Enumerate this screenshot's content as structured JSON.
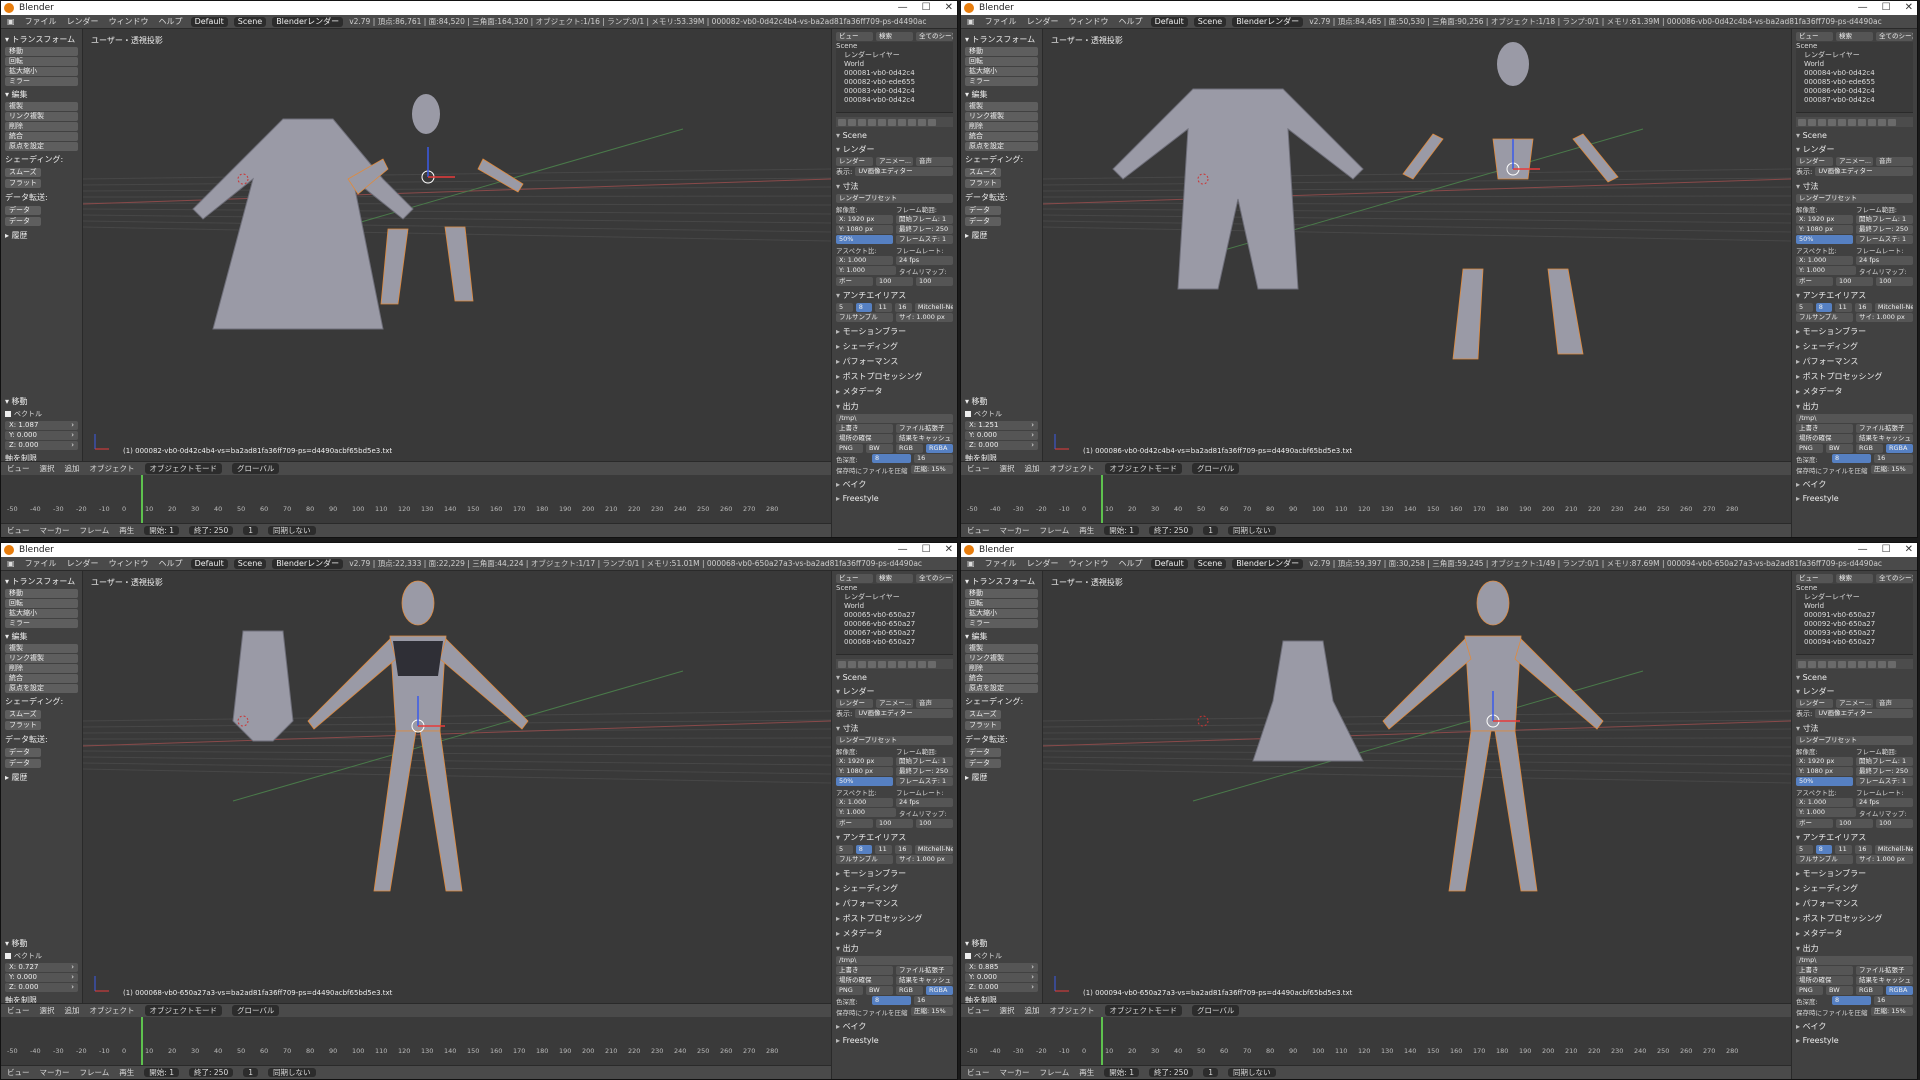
{
  "app_title": "Blender",
  "window_buttons": [
    "—",
    "☐",
    "✕"
  ],
  "menu": [
    "ファイル",
    "レンダー",
    "ウィンドウ",
    "ヘルプ"
  ],
  "layout": "Default",
  "scene": "Scene",
  "engine": "Blenderレンダー",
  "toolshelf": {
    "transform_head": "▾ トランスフォーム",
    "transform_buttons": [
      "移動",
      "回転",
      "拡大縮小",
      "ミラー"
    ],
    "edit_head": "▾ 編集",
    "edit_buttons": [
      "複製",
      "リンク複製",
      "削除",
      "統合"
    ],
    "origin": "原点を設定",
    "shading_head": "シェーディング:",
    "shading_buttons": [
      "スムーズ",
      "フラット"
    ],
    "data_head": "データ転送:",
    "data_buttons": [
      "データ",
      "データ"
    ],
    "history_head": "▸ 履歴",
    "op_head": "▾ 移動",
    "vector_head": "ベクトル",
    "constraint_head": "軸を制限",
    "axes": [
      "X",
      "Y",
      "Z"
    ]
  },
  "viewport_label": "ユーザー・透視投影",
  "viewheader": [
    "ビュー",
    "選択",
    "追加",
    "オブジェクト",
    "オブジェクトモード",
    "グローバル"
  ],
  "timeline_header": [
    "ビュー",
    "マーカー",
    "フレーム",
    "再生",
    "開始:",
    "1",
    "終了:",
    "250",
    "1",
    "同期しない"
  ],
  "timeline_ticks": [
    "-50",
    "-40",
    "-30",
    "-20",
    "-10",
    "0",
    "10",
    "20",
    "30",
    "40",
    "50",
    "60",
    "70",
    "80",
    "90",
    "100",
    "110",
    "120",
    "130",
    "140",
    "150",
    "160",
    "170",
    "180",
    "190",
    "200",
    "210",
    "220",
    "230",
    "240",
    "250",
    "260",
    "270",
    "280"
  ],
  "properties": {
    "header_tabs": [
      "ビュー",
      "検索",
      "全てのシーン"
    ],
    "outliner_items": [
      "Scene",
      "レンダーレイヤー",
      "World"
    ],
    "scene_label": "Scene",
    "render_head": "レンダー",
    "render_buttons": [
      "レンダー",
      "アニメー...",
      "音声"
    ],
    "display_label": "表示:",
    "display_value": "UV画像エディター",
    "dim_head": "寸法",
    "preset": "レンダープリセット",
    "res_label": "解像度:",
    "res_x": "X: 1920 px",
    "res_y": "Y: 1080 px",
    "res_pct": "50%",
    "frame_label": "フレーム範囲:",
    "frame_start": "開始フレーム: 1",
    "frame_end": "最終フレー: 250",
    "frame_step": "フレームステ: 1",
    "aspect_label": "アスペクト比:",
    "aspect_x": "X: 1.000",
    "aspect_y": "Y: 1.000",
    "fps_label": "フレームレート:",
    "fps": "24 fps",
    "time_remap": "タイムリマップ:",
    "remap_old": "100",
    "remap_new": "100",
    "border": "ボー",
    "aa_head": "アンチエイリアス",
    "aa_samples": [
      "5",
      "8",
      "11",
      "16"
    ],
    "aa_filter": "Mitchell-Netravali",
    "full_sample": "フルサンプル",
    "filter_size": "サイ: 1.000 px",
    "closed_sections": [
      "モーションブラー",
      "シェーディング",
      "パフォーマンス",
      "ポストプロセッシング",
      "メタデータ"
    ],
    "output_head": "出力",
    "output_path": "/tmp\\",
    "overwrite": "上書き",
    "file_ext": "ファイル拡張子",
    "placeholders": "場所の確保",
    "cache": "結果をキャッシュ",
    "format": "PNG",
    "color_modes": [
      "BW",
      "RGB",
      "RGBA"
    ],
    "color_label": "色深度:",
    "color_depth": [
      "8",
      "16"
    ],
    "compression": "圧縮: 15%",
    "compression_label": "保存時にファイルを圧縮",
    "bake_head": "ベイク",
    "freestyle_head": "Freestyle"
  },
  "windows": [
    {
      "stats": "v2.79 | 頂点:86,761 | 面:84,520 | 三角面:164,320 | オブジェクト:1/16 | ランプ:0/1 | メモリ:53.39M | 000082-vb0-0d42c4b4-vs-ba2ad81fa36ff709-ps-d4490ac",
      "vector_x": "X: 1.087",
      "vector_y": "Y: 0.000",
      "vector_z": "Z: 0.000",
      "objects": [
        "000081-vb0-0d42c4",
        "000082-vb0-ede655",
        "000083-vb0-0d42c4",
        "000084-vb0-0d42c4"
      ],
      "info": "(1) 000082-vb0-0d42c4b4-vs=ba2ad81fa36ff709-ps=d4490acbf65bd5e3.txt"
    },
    {
      "stats": "v2.79 | 頂点:84,465 | 面:50,530 | 三角面:90,256 | オブジェクト:1/18 | ランプ:0/1 | メモリ:61.39M | 000086-vb0-0d42c4b4-vs-ba2ad81fa36ff709-ps-d4490ac",
      "vector_x": "X: 1.251",
      "vector_y": "Y: 0.000",
      "vector_z": "Z: 0.000",
      "objects": [
        "000084-vb0-0d42c4",
        "000085-vb0-ede655",
        "000086-vb0-0d42c4",
        "000087-vb0-0d42c4"
      ],
      "info": "(1) 000086-vb0-0d42c4b4-vs=ba2ad81fa36ff709-ps=d4490acbf65bd5e3.txt"
    },
    {
      "stats": "v2.79 | 頂点:22,333 | 面:22,229 | 三角面:44,224 | オブジェクト:1/17 | ランプ:0/1 | メモリ:51.01M | 000068-vb0-650a27a3-vs-ba2ad81fa36ff709-ps-d4490ac",
      "vector_x": "X: 0.727",
      "vector_y": "Y: 0.000",
      "vector_z": "Z: 0.000",
      "objects": [
        "000065-vb0-650a27",
        "000066-vb0-650a27",
        "000067-vb0-650a27",
        "000068-vb0-650a27"
      ],
      "info": "(1) 000068-vb0-650a27a3-vs=ba2ad81fa36ff709-ps=d4490acbf65bd5e3.txt"
    },
    {
      "stats": "v2.79 | 頂点:59,397 | 面:30,258 | 三角面:59,245 | オブジェクト:1/49 | ランプ:0/1 | メモリ:87.69M | 000094-vb0-650a27a3-vs-ba2ad81fa36ff709-ps-d4490ac",
      "vector_x": "X: 0.885",
      "vector_y": "Y: 0.000",
      "vector_z": "Z: 0.000",
      "objects": [
        "000091-vb0-650a27",
        "000092-vb0-650a27",
        "000093-vb0-650a27",
        "000094-vb0-650a27"
      ],
      "info": "(1) 000094-vb0-650a27a3-vs=ba2ad81fa36ff709-ps=d4490acbf65bd5e3.txt"
    }
  ]
}
